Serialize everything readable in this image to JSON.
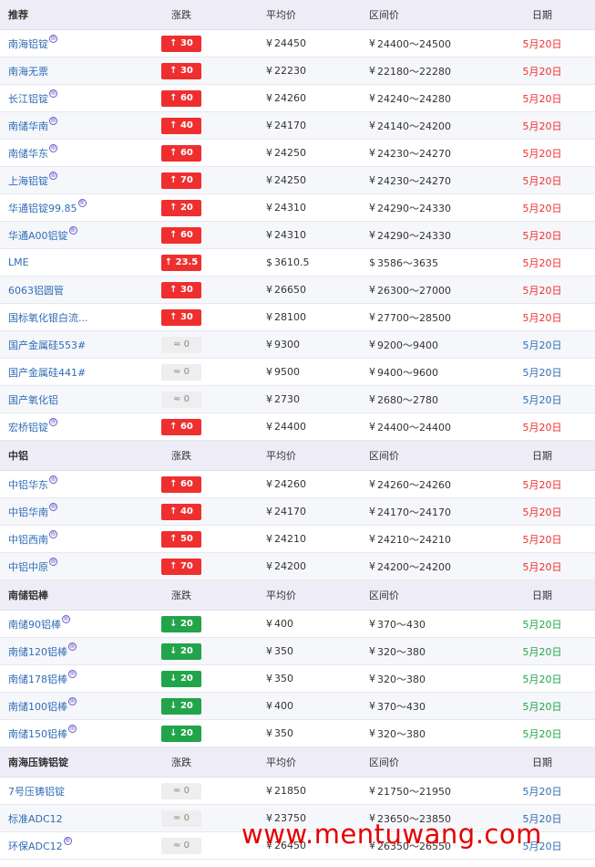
{
  "columns": {
    "change": "涨跌",
    "avg": "平均价",
    "range": "区间价",
    "date": "日期"
  },
  "sections": [
    {
      "title": "推荐",
      "rows": [
        {
          "name": "南海铝锭",
          "tag": true,
          "change": "30",
          "dir": "up",
          "avg": "24450",
          "cur": "¥",
          "range": "24400～24500",
          "date": "5月20日"
        },
        {
          "name": "南海无票",
          "tag": false,
          "change": "30",
          "dir": "up",
          "avg": "22230",
          "cur": "¥",
          "range": "22180～22280",
          "date": "5月20日"
        },
        {
          "name": "长江铝锭",
          "tag": true,
          "change": "60",
          "dir": "up",
          "avg": "24260",
          "cur": "¥",
          "range": "24240～24280",
          "date": "5月20日"
        },
        {
          "name": "南储华南",
          "tag": true,
          "change": "40",
          "dir": "up",
          "avg": "24170",
          "cur": "¥",
          "range": "24140～24200",
          "date": "5月20日"
        },
        {
          "name": "南储华东",
          "tag": true,
          "change": "60",
          "dir": "up",
          "avg": "24250",
          "cur": "¥",
          "range": "24230～24270",
          "date": "5月20日"
        },
        {
          "name": "上海铝锭",
          "tag": true,
          "change": "70",
          "dir": "up",
          "avg": "24250",
          "cur": "¥",
          "range": "24230～24270",
          "date": "5月20日"
        },
        {
          "name": "华通铝锭99.85",
          "tag": true,
          "change": "20",
          "dir": "up",
          "avg": "24310",
          "cur": "¥",
          "range": "24290～24330",
          "date": "5月20日"
        },
        {
          "name": "华通A00铝锭",
          "tag": true,
          "change": "60",
          "dir": "up",
          "avg": "24310",
          "cur": "¥",
          "range": "24290～24330",
          "date": "5月20日"
        },
        {
          "name": "LME",
          "tag": false,
          "change": "23.5",
          "dir": "up",
          "avg": "3610.5",
          "cur": "$",
          "range": "3586～3635",
          "date": "5月20日"
        },
        {
          "name": "6063铝圆管",
          "tag": false,
          "change": "30",
          "dir": "up",
          "avg": "26650",
          "cur": "¥",
          "range": "26300～27000",
          "date": "5月20日"
        },
        {
          "name": "国标氧化银白流...",
          "tag": false,
          "change": "30",
          "dir": "up",
          "avg": "28100",
          "cur": "¥",
          "range": "27700～28500",
          "date": "5月20日"
        },
        {
          "name": "国产金属硅553#",
          "tag": false,
          "change": "0",
          "dir": "flat",
          "avg": "9300",
          "cur": "¥",
          "range": "9200～9400",
          "date": "5月20日"
        },
        {
          "name": "国产金属硅441#",
          "tag": false,
          "change": "0",
          "dir": "flat",
          "avg": "9500",
          "cur": "¥",
          "range": "9400～9600",
          "date": "5月20日"
        },
        {
          "name": "国产氧化铝",
          "tag": false,
          "change": "0",
          "dir": "flat",
          "avg": "2730",
          "cur": "¥",
          "range": "2680～2780",
          "date": "5月20日"
        },
        {
          "name": "宏桥铝锭",
          "tag": true,
          "change": "60",
          "dir": "up",
          "avg": "24400",
          "cur": "¥",
          "range": "24400～24400",
          "date": "5月20日"
        }
      ]
    },
    {
      "title": "中铝",
      "rows": [
        {
          "name": "中铝华东",
          "tag": true,
          "change": "60",
          "dir": "up",
          "avg": "24260",
          "cur": "¥",
          "range": "24260～24260",
          "date": "5月20日"
        },
        {
          "name": "中铝华南",
          "tag": true,
          "change": "40",
          "dir": "up",
          "avg": "24170",
          "cur": "¥",
          "range": "24170～24170",
          "date": "5月20日"
        },
        {
          "name": "中铝西南",
          "tag": true,
          "change": "50",
          "dir": "up",
          "avg": "24210",
          "cur": "¥",
          "range": "24210～24210",
          "date": "5月20日"
        },
        {
          "name": "中铝中原",
          "tag": true,
          "change": "70",
          "dir": "up",
          "avg": "24200",
          "cur": "¥",
          "range": "24200～24200",
          "date": "5月20日"
        }
      ]
    },
    {
      "title": "南储铝棒",
      "rows": [
        {
          "name": "南储90铝棒",
          "tag": true,
          "change": "20",
          "dir": "down",
          "avg": "400",
          "cur": "¥",
          "range": "370～430",
          "date": "5月20日"
        },
        {
          "name": "南储120铝棒",
          "tag": true,
          "change": "20",
          "dir": "down",
          "avg": "350",
          "cur": "¥",
          "range": "320～380",
          "date": "5月20日"
        },
        {
          "name": "南储178铝棒",
          "tag": true,
          "change": "20",
          "dir": "down",
          "avg": "350",
          "cur": "¥",
          "range": "320～380",
          "date": "5月20日"
        },
        {
          "name": "南储100铝棒",
          "tag": true,
          "change": "20",
          "dir": "down",
          "avg": "400",
          "cur": "¥",
          "range": "370～430",
          "date": "5月20日"
        },
        {
          "name": "南储150铝棒",
          "tag": true,
          "change": "20",
          "dir": "down",
          "avg": "350",
          "cur": "¥",
          "range": "320～380",
          "date": "5月20日"
        }
      ]
    },
    {
      "title": "南海压铸铝锭",
      "rows": [
        {
          "name": "7号压铸铝锭",
          "tag": false,
          "change": "0",
          "dir": "flat",
          "avg": "21850",
          "cur": "¥",
          "range": "21750～21950",
          "date": "5月20日"
        },
        {
          "name": "标准ADC12",
          "tag": false,
          "change": "0",
          "dir": "flat",
          "avg": "23750",
          "cur": "¥",
          "range": "23650～23850",
          "date": "5月20日"
        },
        {
          "name": "环保ADC12",
          "tag": true,
          "change": "0",
          "dir": "flat",
          "avg": "26450",
          "cur": "¥",
          "range": "26350～26550",
          "date": "5月20日"
        }
      ]
    }
  ],
  "icons": {
    "up": "↑",
    "down": "↓",
    "flat": "≈",
    "tag": "图"
  },
  "colors": {
    "up": "#ef2f2f",
    "down": "#21a44a",
    "flat_date": "#2f6db5",
    "link": "#2f6db5",
    "header_bg": "#eeedf7"
  },
  "watermark": "www.mentuwang.com"
}
